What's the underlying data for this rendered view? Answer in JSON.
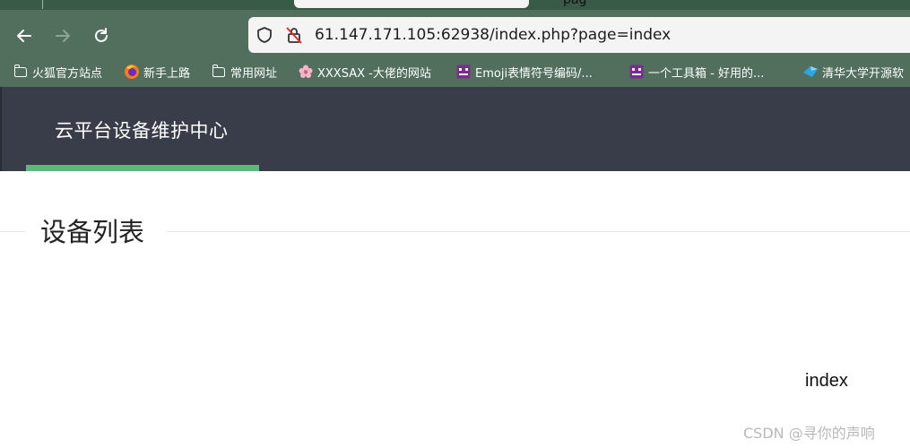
{
  "browser": {
    "address": "61.147.171.105:62938/index.php?page=index",
    "tab_partial_text": "pag",
    "bookmarks": [
      {
        "icon": "folder-icon",
        "label": "火狐官方站点"
      },
      {
        "icon": "firefox-icon",
        "label": "新手上路"
      },
      {
        "icon": "folder-icon",
        "label": "常用网址"
      },
      {
        "icon": "sakura-icon",
        "label": "XXXSAX -大佬的网站"
      },
      {
        "icon": "emoji-icon",
        "label": "Emoji表情符号编码/..."
      },
      {
        "icon": "emoji-icon",
        "label": "一个工具箱 - 好用的..."
      },
      {
        "icon": "tsinghua-icon",
        "label": "清华大学开源软"
      }
    ]
  },
  "header": {
    "brand": "云平台设备维护中心"
  },
  "main": {
    "section_title": "设备列表",
    "page_value": "index"
  },
  "watermark": "CSDN @寻你的声响",
  "colors": {
    "chrome": "#516f5c",
    "header_bg": "#393d49",
    "active_nav": "#5fb878"
  }
}
